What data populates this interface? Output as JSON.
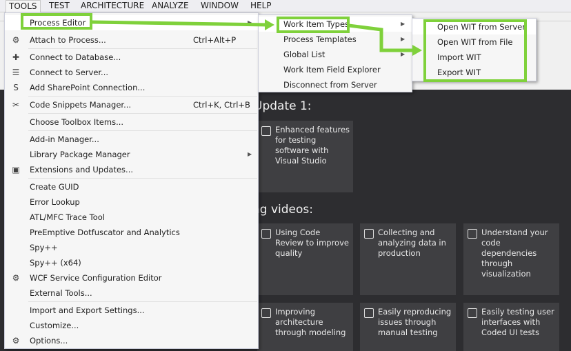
{
  "menubar": {
    "items": [
      "TOOLS",
      "TEST",
      "ARCHITECTURE",
      "ANALYZE",
      "WINDOW",
      "HELP"
    ]
  },
  "tools_menu": {
    "items": [
      {
        "label": "Process Editor",
        "shortcut": "",
        "submenu": true,
        "icon": ""
      },
      {
        "label": "Attach to Process...",
        "shortcut": "Ctrl+Alt+P",
        "submenu": false,
        "icon": "gear-cluster-icon"
      },
      {
        "label": "Connect to Database...",
        "shortcut": "",
        "submenu": false,
        "icon": "database-plug-icon"
      },
      {
        "label": "Connect to Server...",
        "shortcut": "",
        "submenu": false,
        "icon": "server-plug-icon"
      },
      {
        "label": "Add SharePoint Connection...",
        "shortcut": "",
        "submenu": false,
        "icon": "sharepoint-icon"
      },
      {
        "label": "Code Snippets Manager...",
        "shortcut": "Ctrl+K, Ctrl+B",
        "submenu": false,
        "icon": "snippet-icon"
      },
      {
        "label": "Choose Toolbox Items...",
        "shortcut": "",
        "submenu": false,
        "icon": ""
      },
      {
        "label": "Add-in Manager...",
        "shortcut": "",
        "submenu": false,
        "icon": ""
      },
      {
        "label": "Library Package Manager",
        "shortcut": "",
        "submenu": true,
        "icon": ""
      },
      {
        "label": "Extensions and Updates...",
        "shortcut": "",
        "submenu": false,
        "icon": "extensions-icon"
      },
      {
        "label": "Create GUID",
        "shortcut": "",
        "submenu": false,
        "icon": ""
      },
      {
        "label": "Error Lookup",
        "shortcut": "",
        "submenu": false,
        "icon": ""
      },
      {
        "label": "ATL/MFC Trace Tool",
        "shortcut": "",
        "submenu": false,
        "icon": ""
      },
      {
        "label": "PreEmptive Dotfuscator and Analytics",
        "shortcut": "",
        "submenu": false,
        "icon": ""
      },
      {
        "label": "Spy++",
        "shortcut": "",
        "submenu": false,
        "icon": ""
      },
      {
        "label": "Spy++ (x64)",
        "shortcut": "",
        "submenu": false,
        "icon": ""
      },
      {
        "label": "WCF Service Configuration Editor",
        "shortcut": "",
        "submenu": false,
        "icon": "wcf-config-icon"
      },
      {
        "label": "External Tools...",
        "shortcut": "",
        "submenu": false,
        "icon": ""
      },
      {
        "label": "Import and Export Settings...",
        "shortcut": "",
        "submenu": false,
        "icon": ""
      },
      {
        "label": "Customize...",
        "shortcut": "",
        "submenu": false,
        "icon": ""
      },
      {
        "label": "Options...",
        "shortcut": "",
        "submenu": false,
        "icon": "gear-icon"
      }
    ]
  },
  "process_menu": {
    "items": [
      {
        "label": "Work Item Types",
        "submenu": true
      },
      {
        "label": "Process Templates",
        "submenu": true
      },
      {
        "label": "Global List",
        "submenu": true
      },
      {
        "label": "Work Item Field Explorer",
        "submenu": false
      },
      {
        "label": "Disconnect from Server",
        "submenu": false
      }
    ]
  },
  "wit_menu": {
    "items": [
      "Open WIT from Server",
      "Open WIT from File",
      "Import WIT",
      "Export WIT"
    ]
  },
  "startpage": {
    "heading_update": "Update 1:",
    "heading_videos": "ng videos:",
    "tiles": [
      {
        "text": "Enhanced features for testing software with Visual Studio",
        "icon": "testing-icon"
      },
      {
        "text": "Using Code Review to improve quality",
        "icon": "code-review-icon"
      },
      {
        "text": "Collecting and analyzing data in production",
        "icon": "data-icon"
      },
      {
        "text": "Understand your code dependencies through visualization",
        "icon": "dependency-icon"
      },
      {
        "text": "Improving architecture through modeling",
        "icon": "architecture-icon"
      },
      {
        "text": "Easily reproducing issues through manual testing",
        "icon": "manual-test-icon"
      },
      {
        "text": "Easily testing user interfaces with Coded UI tests",
        "icon": "flask-icon"
      }
    ]
  },
  "colors": {
    "highlight_green": "#7fd13b",
    "menu_bg": "#f6f6f6",
    "startpage_bg": "#2d2d30",
    "tile_bg": "#3f3f42"
  }
}
